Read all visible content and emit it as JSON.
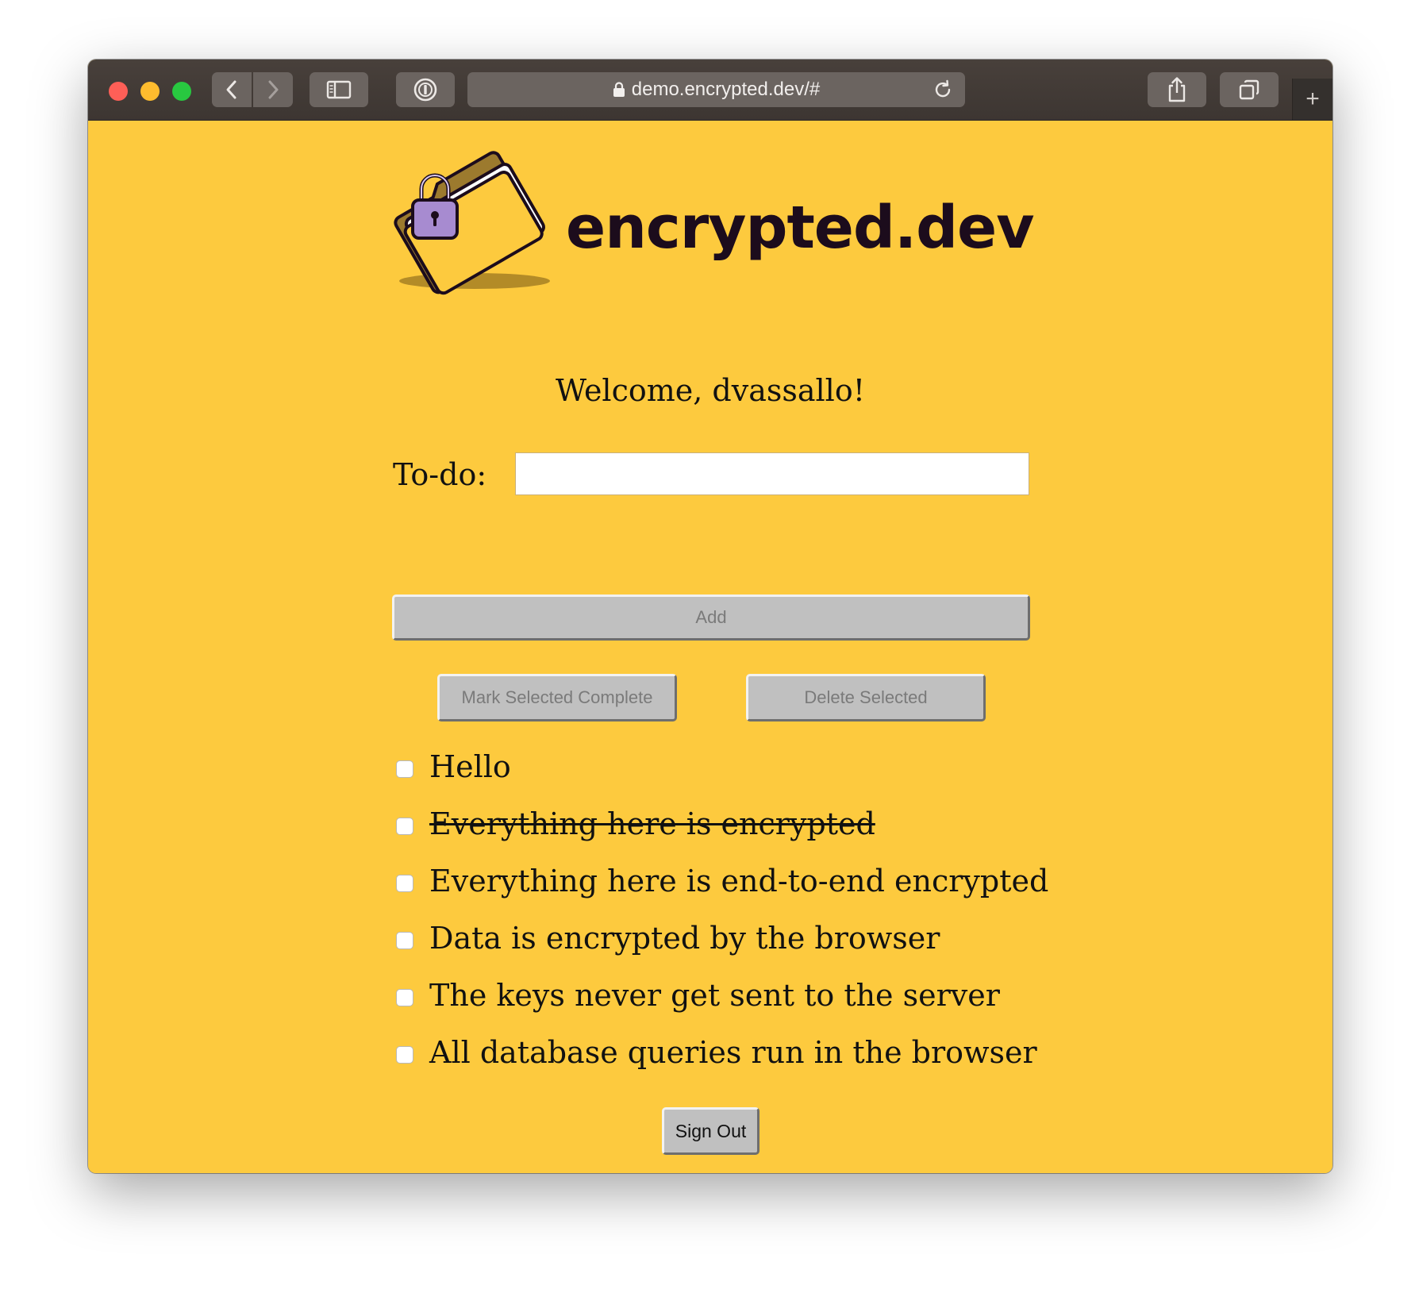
{
  "browser": {
    "url": "demo.encrypted.dev/#",
    "new_tab_label": "+"
  },
  "app": {
    "logo_text": "encrypted.dev",
    "welcome": "Welcome, dvassallo!",
    "todo_label": "To-do:",
    "todo_input_value": "",
    "add_label": "Add",
    "mark_complete_label": "Mark Selected Complete",
    "delete_label": "Delete Selected",
    "sign_out_label": "Sign Out",
    "todos": [
      {
        "text": "Hello",
        "completed": false
      },
      {
        "text": "Everything here is encrypted",
        "completed": true
      },
      {
        "text": "Everything here is end-to-end encrypted",
        "completed": false
      },
      {
        "text": "Data is encrypted by the browser",
        "completed": false
      },
      {
        "text": "The keys never get sent to the server",
        "completed": false
      },
      {
        "text": "All database queries run in the browser",
        "completed": false
      }
    ]
  },
  "colors": {
    "background": "#fdca3e",
    "text": "#111111",
    "button": "#c0c0c0",
    "lock": "#a78bd0"
  }
}
